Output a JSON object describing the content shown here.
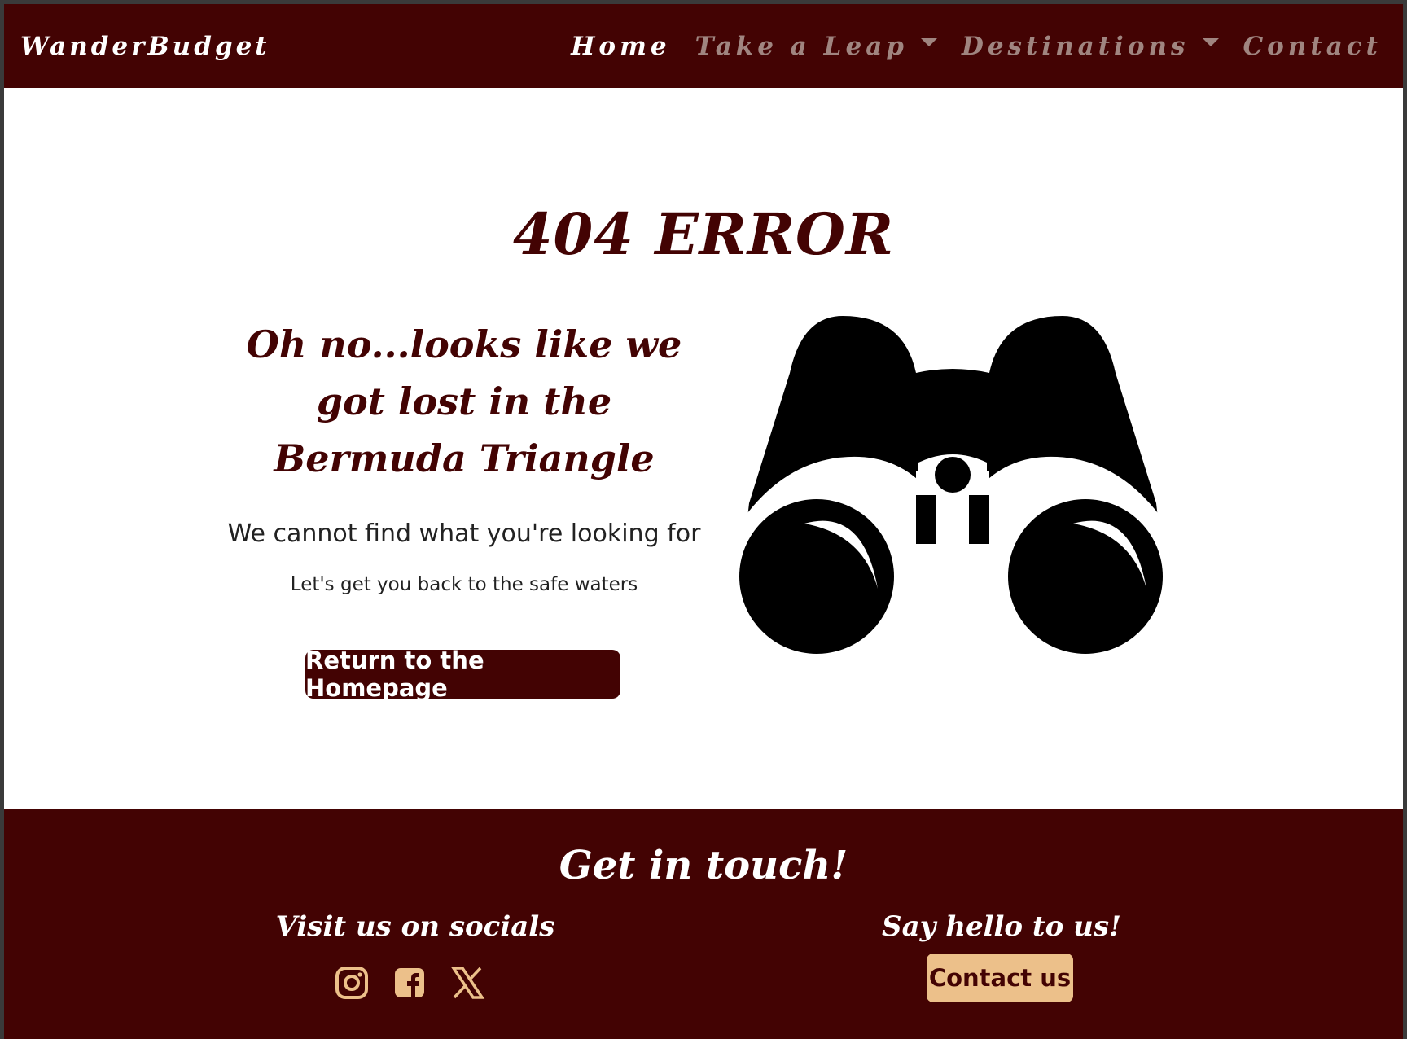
{
  "nav": {
    "brand": "WanderBudget",
    "items": [
      {
        "label": "Home",
        "active": true,
        "dropdown": false
      },
      {
        "label": "Take a Leap",
        "active": false,
        "dropdown": true
      },
      {
        "label": "Destinations",
        "active": false,
        "dropdown": true
      },
      {
        "label": "Contact",
        "active": false,
        "dropdown": false
      }
    ]
  },
  "main": {
    "title": "404 ERROR",
    "headline": "Oh no...looks like we got lost in the Bermuda Triangle",
    "subtitle": "We cannot find what you're looking for",
    "note": "Let's get you back to the safe waters",
    "return_button": "Return to the Homepage",
    "illustration": "binoculars-icon"
  },
  "footer": {
    "title": "Get in touch!",
    "socials_heading": "Visit us on socials",
    "socials": [
      "instagram-icon",
      "facebook-icon",
      "x-twitter-icon"
    ],
    "hello_heading": "Say hello to us!",
    "contact_button": "Contact us"
  },
  "colors": {
    "primary": "#430303",
    "accent": "#ecc08a",
    "nav_inactive": "#a08580"
  }
}
